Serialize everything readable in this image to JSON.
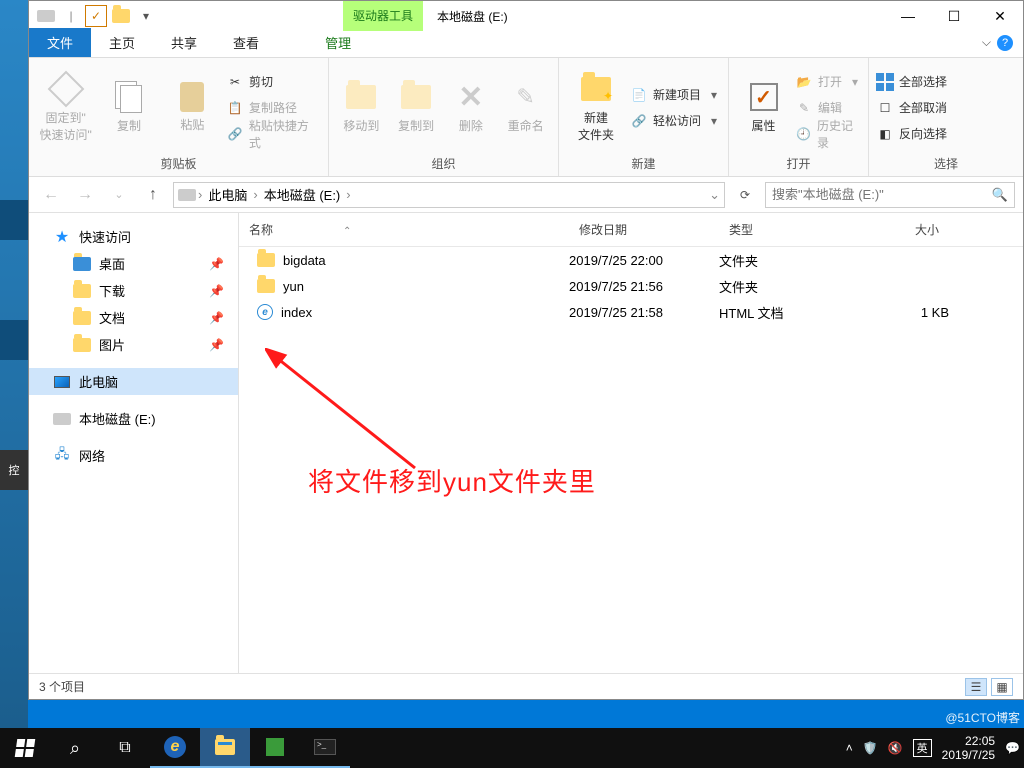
{
  "window": {
    "driver_tools": "驱动器工具",
    "title": "本地磁盘 (E:)"
  },
  "tabs": {
    "file": "文件",
    "home": "主页",
    "share": "共享",
    "view": "查看",
    "manage": "管理"
  },
  "ribbon": {
    "pin_label1": "固定到\"",
    "pin_label2": "快速访问\"",
    "copy": "复制",
    "paste": "粘贴",
    "cut": "剪切",
    "copy_path": "复制路径",
    "paste_shortcut": "粘贴快捷方式",
    "clipboard": "剪贴板",
    "move_to": "移动到",
    "copy_to": "复制到",
    "delete": "删除",
    "rename": "重命名",
    "organize": "组织",
    "new_folder1": "新建",
    "new_folder2": "文件夹",
    "new_item": "新建项目",
    "easy_access": "轻松访问",
    "new": "新建",
    "properties": "属性",
    "open": "打开",
    "edit": "编辑",
    "history": "历史记录",
    "open_group": "打开",
    "select_all": "全部选择",
    "select_none": "全部取消",
    "invert": "反向选择",
    "select": "选择"
  },
  "breadcrumb": {
    "root": "此电脑",
    "loc": "本地磁盘 (E:)"
  },
  "search": {
    "placeholder": "搜索\"本地磁盘 (E:)\""
  },
  "nav": {
    "quick": "快速访问",
    "desktop": "桌面",
    "downloads": "下载",
    "documents": "文档",
    "pictures": "图片",
    "thispc": "此电脑",
    "edrive": "本地磁盘 (E:)",
    "network": "网络"
  },
  "columns": {
    "name": "名称",
    "date": "修改日期",
    "type": "类型",
    "size": "大小"
  },
  "files": [
    {
      "name": "bigdata",
      "date": "2019/7/25 22:00",
      "type": "文件夹",
      "size": "",
      "kind": "folder"
    },
    {
      "name": "yun",
      "date": "2019/7/25 21:56",
      "type": "文件夹",
      "size": "",
      "kind": "folder"
    },
    {
      "name": "index",
      "date": "2019/7/25 21:58",
      "type": "HTML 文档",
      "size": "1 KB",
      "kind": "html"
    }
  ],
  "status": {
    "count": "3 个项目"
  },
  "annotation": "将文件移到yun文件夹里",
  "tray": {
    "ime": "英",
    "time": "22:05",
    "date": "2019/7/25"
  },
  "watermark": "@51CTO博客"
}
